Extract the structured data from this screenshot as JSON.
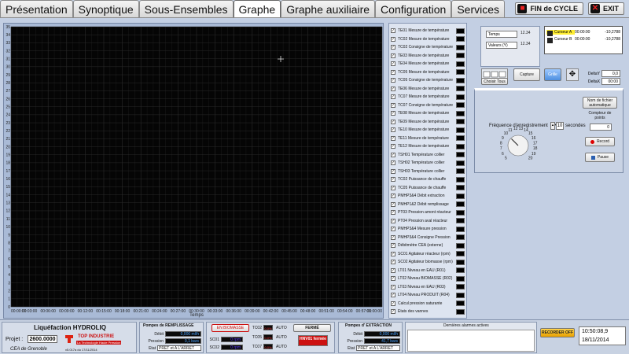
{
  "tabs": [
    {
      "label": "Présentation",
      "active": false
    },
    {
      "label": "Synoptique",
      "active": false
    },
    {
      "label": "Sous-Ensembles",
      "active": false
    },
    {
      "label": "Graphe",
      "active": true
    },
    {
      "label": "Graphe auxiliaire",
      "active": false
    },
    {
      "label": "Configuration",
      "active": false
    },
    {
      "label": "Services",
      "active": false
    }
  ],
  "top_buttons": {
    "end_cycle": "FIN de CYCLE",
    "exit": "EXIT"
  },
  "graph": {
    "x_label": "Temps",
    "y_ticks": [
      "35",
      "34",
      "33",
      "32",
      "31",
      "30",
      "29",
      "28",
      "27",
      "26",
      "25",
      "24",
      "23",
      "22",
      "21",
      "20",
      "19",
      "18",
      "17",
      "16",
      "15",
      "14",
      "13",
      "12",
      "11",
      "10",
      "9",
      "8",
      "7",
      "6",
      "5",
      "4",
      "3",
      "2",
      "1",
      "0"
    ],
    "x_ticks": [
      "00:00:00",
      "00:03:00",
      "00:06:00",
      "00:09:00",
      "00:12:00",
      "00:15:00",
      "00:18:00",
      "00:21:00",
      "00:24:00",
      "00:27:00",
      "00:30:00",
      "00:33:00",
      "00:36:00",
      "00:39:00",
      "00:42:00",
      "00:45:00",
      "00:48:00",
      "00:51:00",
      "00:54:00",
      "00:57:00",
      "01:00:00"
    ],
    "plot_bg": "#050505",
    "grid_color": "#2a2a2a"
  },
  "legend": [
    {
      "label": "TE01 Mesure de température",
      "checked": true
    },
    {
      "label": "TC02 Mesure de température",
      "checked": true
    },
    {
      "label": "TC02 Consigne de température",
      "checked": true
    },
    {
      "label": "TE03 Mesure de température",
      "checked": true
    },
    {
      "label": "TE04 Mesure de température",
      "checked": true
    },
    {
      "label": "TC05 Mesure de température",
      "checked": true
    },
    {
      "label": "TC05 Consigne de température",
      "checked": true
    },
    {
      "label": "TE06 Mesure de température",
      "checked": true
    },
    {
      "label": "TC07 Mesure de température",
      "checked": true
    },
    {
      "label": "TC07 Consigne de température",
      "checked": true
    },
    {
      "label": "TE08 Mesure de température",
      "checked": true
    },
    {
      "label": "TE09 Mesure de température",
      "checked": true
    },
    {
      "label": "TE10 Mesure de température",
      "checked": true
    },
    {
      "label": "TE11 Mesure de température",
      "checked": true
    },
    {
      "label": "TE12 Mesure de température",
      "checked": true
    },
    {
      "label": "TSH01 Température collier",
      "checked": true
    },
    {
      "label": "TSH02 Température collier",
      "checked": true
    },
    {
      "label": "TSH03 Température collier",
      "checked": true
    },
    {
      "label": "TC02 Puissance de chauffe",
      "checked": true
    },
    {
      "label": "TC05 Puissance de chauffe",
      "checked": true
    },
    {
      "label": "PMHP3&4 Débit extraction",
      "checked": true
    },
    {
      "label": "PMHP1&2 Débit remplissage",
      "checked": true
    },
    {
      "label": "PT03 Pression amont réacteur",
      "checked": true
    },
    {
      "label": "PT04 Pression aval réacteur",
      "checked": true
    },
    {
      "label": "PMHP3&4 Mesure pression",
      "checked": true
    },
    {
      "label": "PMHP3&4 Consigne Pression",
      "checked": true
    },
    {
      "label": "Débitmètre CEA (externe)",
      "checked": true
    },
    {
      "label": "SC01 Agitateur réacteur (rpm)",
      "checked": true
    },
    {
      "label": "SC02 Agitateur biomasse (rpm)",
      "checked": true
    },
    {
      "label": "LT01 Niveau en EAU (R01)",
      "checked": true
    },
    {
      "label": "LT02 Niveau BIOMASSE (R02)",
      "checked": true
    },
    {
      "label": "LT03 Niveau en EAU (R03)",
      "checked": true
    },
    {
      "label": "LT04 Niveau PRODUIT (R04)",
      "checked": true
    },
    {
      "label": "Calcul pression saturante",
      "checked": true
    },
    {
      "label": "Etats des vannes",
      "checked": true
    }
  ],
  "cursor_box": {
    "field_time": "Temps",
    "field_values": "Valeurs (Y)",
    "mini1": "12.34",
    "mini2": "12.34"
  },
  "cursor_table": [
    {
      "name": "Curseur A",
      "time": "00:00:00",
      "value": "-10,2788",
      "highlight": true
    },
    {
      "name": "Curseur B",
      "time": "00:00:00",
      "value": "-10,2788",
      "highlight": false
    }
  ],
  "buttons": {
    "choose_all": "Choisir Tous",
    "capture": "Capture",
    "grid": "Grille"
  },
  "delta": [
    {
      "label": "DeltaY",
      "value": "0,0"
    },
    {
      "label": "DeltaX",
      "value": "00:00"
    }
  ],
  "recording": {
    "freq_label": "Fréquence d'enregistrement",
    "freq_value": "10",
    "freq_unit": "secondes",
    "filename_btn": "Nom de fichier automatique",
    "counter_label": "Compteur de points",
    "counter_value": "0",
    "record_btn": "Record",
    "pause_btn": "Pause",
    "dial_ticks": [
      "5",
      "6",
      "7",
      "8",
      "9",
      "10",
      "11",
      "12",
      "13",
      "14",
      "15",
      "16",
      "17",
      "18",
      "19",
      "20"
    ],
    "dial_value": "10"
  },
  "status": {
    "app_title": "Liquéfaction HYDROLIQ",
    "project_label": "Projet :",
    "project_value": "2600.0000",
    "client": "CEA de Grenoble",
    "logo_name": "TOP INDUSTRIE",
    "logo_tagline": "La Technologie Haute Pression",
    "version": "v5.017a du 17/11/2014",
    "fill_pumps": {
      "title": "Pompes de REMPLISSAGE",
      "debit_label": "Débit",
      "debit_value": "0,000 ml/h",
      "pression_label": "Pression",
      "pression_value": "0,1 bars",
      "etat_label": "Etat",
      "etat_value": "PRET et A L'ARRET"
    },
    "biomass_btn": "EN BIOMASSE",
    "sc01": {
      "label": "SC01",
      "value": "0 rpm"
    },
    "sc02": {
      "label": "SC02",
      "value": "0 rpm"
    },
    "tc_rows": [
      {
        "label": "TC02",
        "value": "0.0%",
        "mode": "AUTO"
      },
      {
        "label": "TC05",
        "value": "0.0%",
        "mode": "AUTO"
      },
      {
        "label": "TC07",
        "value": "0.0%",
        "mode": "AUTO"
      }
    ],
    "ferme_btn": "FERMÉ",
    "valve_label": "HNV01 fermée",
    "extract_pumps": {
      "title": "Pompes d' EXTRACTION",
      "debit_label": "Débit",
      "debit_value": "0,000 ml/h",
      "pression_label": "Pression",
      "pression_value": "41,7 bars",
      "etat_label": "Etat",
      "etat_value": "PRET et A L'ARRET"
    },
    "alarms_title": "Dernières alarmes actives",
    "recorder_btn": "RECORDER OFF",
    "time": "10:50:08,9",
    "date": "18/11/2014"
  }
}
